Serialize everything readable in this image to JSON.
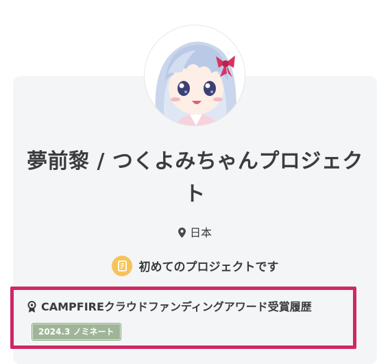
{
  "project": {
    "title": "夢前黎 / つくよみちゃんプロジェクト",
    "location": "日本",
    "first_project_label": "初めてのプロジェクトです"
  },
  "award": {
    "heading": "CAMPFIREクラウドファンディングアワード受賞履歴",
    "badge": "2024.3 ノミネート"
  },
  "icons": {
    "location": "map-pin-icon",
    "first_project": "first-project-badge-icon",
    "award": "award-medal-icon"
  },
  "colors": {
    "highlight_border": "#cf2864",
    "badge_bg": "#9fb598",
    "first_badge": "#f6c35b",
    "card_bg": "#f3f5f7"
  }
}
